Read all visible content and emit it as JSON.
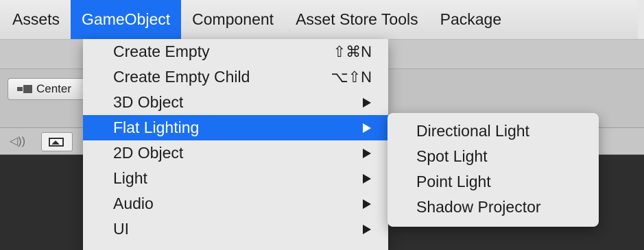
{
  "menubar": {
    "items": [
      {
        "label": "Assets",
        "active": false
      },
      {
        "label": "GameObject",
        "active": true
      },
      {
        "label": "Component",
        "active": false
      },
      {
        "label": "Asset Store Tools",
        "active": false
      },
      {
        "label": "Package",
        "active": false
      }
    ]
  },
  "toolbar": {
    "center_label": "Center"
  },
  "dropdown": {
    "items": [
      {
        "label": "Create Empty",
        "shortcut": "⇧⌘N"
      },
      {
        "label": "Create Empty Child",
        "shortcut": "⌥⇧N"
      },
      {
        "label": "3D Object",
        "submenu": true
      },
      {
        "label": "Flat Lighting",
        "submenu": true,
        "highlighted": true
      },
      {
        "label": "2D Object",
        "submenu": true
      },
      {
        "label": "Light",
        "submenu": true
      },
      {
        "label": "Audio",
        "submenu": true
      },
      {
        "label": "UI",
        "submenu": true
      }
    ]
  },
  "submenu": {
    "items": [
      {
        "label": "Directional Light"
      },
      {
        "label": "Spot Light"
      },
      {
        "label": "Point Light"
      },
      {
        "label": "Shadow Projector"
      }
    ]
  },
  "colors": {
    "accent": "#1b6ff2",
    "menu_bg": "#e9e9e9",
    "scene_bg": "#2e2e2e"
  }
}
